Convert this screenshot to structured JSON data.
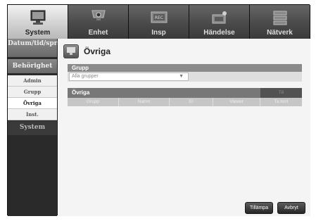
{
  "nav": {
    "tabs": [
      {
        "label": "System",
        "icon": "system-monitor-icon"
      },
      {
        "label": "Enhet",
        "icon": "camera-icon"
      },
      {
        "label": "Insp",
        "icon": "recorder-icon"
      },
      {
        "label": "Händelse",
        "icon": "event-icon"
      },
      {
        "label": "Nätverk",
        "icon": "network-icon"
      }
    ],
    "active": "System"
  },
  "sidebar": {
    "section_datetime": "Datum/tid/språk",
    "section_permission": "Behörighet",
    "items": [
      "Admin",
      "Grupp",
      "Övriga",
      "Inst."
    ],
    "active_item": "Övriga",
    "section_system": "System"
  },
  "main": {
    "title": "Övriga",
    "group_header": "Grupp",
    "group_select": "Alla grupper",
    "other_header": "Övriga",
    "other_tab": "Till",
    "columns": [
      "Grupp",
      "Namn",
      "ID",
      "Viewer",
      "Ta bort"
    ]
  },
  "buttons": {
    "apply": "Tillämpa",
    "cancel": "Avbryt"
  }
}
